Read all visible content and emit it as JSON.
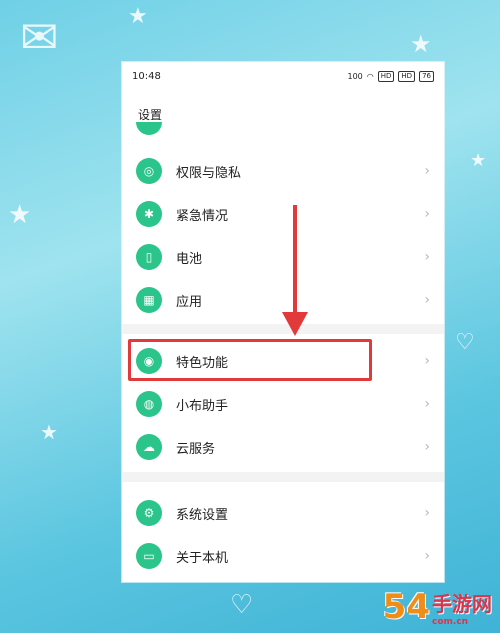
{
  "status_bar": {
    "time": "10:48",
    "network": "100",
    "hd1": "HD",
    "hd2": "HD",
    "battery": "76"
  },
  "page": {
    "title": "设置"
  },
  "menu": {
    "items": [
      {
        "label": "权限与隐私",
        "icon": "privacy-icon"
      },
      {
        "label": "紧急情况",
        "icon": "emergency-icon"
      },
      {
        "label": "电池",
        "icon": "battery-icon"
      },
      {
        "label": "应用",
        "icon": "apps-grid-icon"
      },
      {
        "label": "特色功能",
        "icon": "special-features-icon"
      },
      {
        "label": "小布助手",
        "icon": "assistant-icon"
      },
      {
        "label": "云服务",
        "icon": "cloud-icon"
      },
      {
        "label": "系统设置",
        "icon": "system-settings-icon"
      },
      {
        "label": "关于本机",
        "icon": "phone-icon"
      }
    ],
    "chevron": "›"
  },
  "annotation": {
    "highlighted_item": "特色功能",
    "color": "#e23a3a"
  },
  "watermark": {
    "number": "54",
    "text": "手游网",
    "domain": "com.cn"
  },
  "colors": {
    "icon_green": "#2bc48a",
    "accent_red": "#e23a3a",
    "background": "#6fd0e6"
  }
}
